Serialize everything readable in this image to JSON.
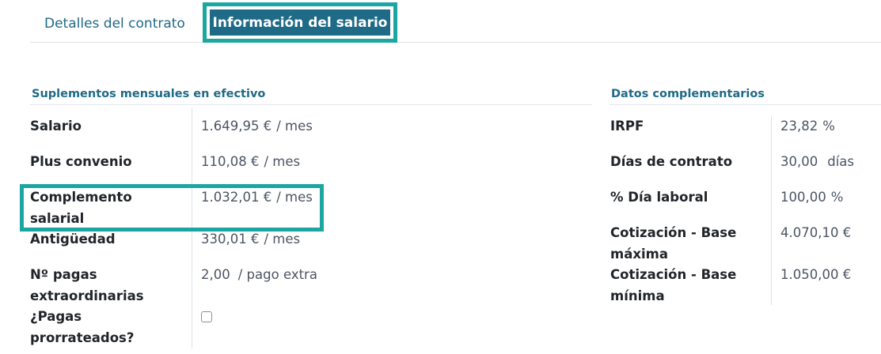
{
  "tabs": [
    {
      "label": "Detalles del contrato",
      "active": false
    },
    {
      "label": "Información del salario",
      "active": true
    }
  ],
  "left_section": {
    "title": "Suplementos mensuales en efectivo",
    "rows": [
      {
        "label": "Salario",
        "value": "1.649,95 €",
        "unit": "/ mes"
      },
      {
        "label": "Plus convenio",
        "value": "110,08 €",
        "unit": "/ mes"
      },
      {
        "label": "Complemento salarial",
        "value": "1.032,01 €",
        "unit": "/ mes"
      },
      {
        "label": "Antigüedad",
        "value": "330,01 €",
        "unit": "/ mes"
      },
      {
        "label": "Nº pagas extraordinarias",
        "value": "2,00",
        "unit": "/ pago extra"
      },
      {
        "label": "¿Pagas prorrateados?",
        "checked": false
      }
    ]
  },
  "right_section": {
    "title": "Datos complementarios",
    "rows": [
      {
        "label": "IRPF",
        "value": "23,82",
        "unit": "%"
      },
      {
        "label": "Días de contrato",
        "value": "30,00",
        "unit": "días"
      },
      {
        "label": "% Día laboral",
        "value": "100,00",
        "unit": "%"
      },
      {
        "label": "Cotización - Base máxima",
        "value": "4.070,10 €",
        "unit": ""
      },
      {
        "label": "Cotización - Base mínima",
        "value": "1.050,00 €",
        "unit": ""
      }
    ]
  },
  "colors": {
    "accent": "#1f6a87",
    "highlight_frame": "#1ba6a1"
  }
}
